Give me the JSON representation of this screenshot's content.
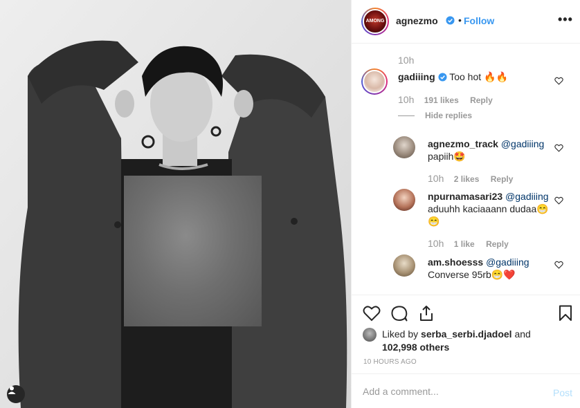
{
  "header": {
    "username": "agnezmo",
    "avatar_text": "AMONG",
    "separator": "•",
    "follow_label": "Follow",
    "more_label": "•••",
    "verified_icon": "verified-badge-icon",
    "accent_color": "#3897f0"
  },
  "comments": {
    "top_timestamp": "10h",
    "main": {
      "username": "gadiiing",
      "text": "Too hot 🔥🔥",
      "timestamp": "10h",
      "likes": "191 likes",
      "reply_label": "Reply",
      "hide_replies_label": "Hide replies"
    },
    "replies": [
      {
        "username": "agnezmo_track",
        "mention": "@gadiiing",
        "text": "papiih🤩",
        "timestamp": "10h",
        "likes": "2 likes",
        "reply_label": "Reply"
      },
      {
        "username": "npurnamasari23",
        "mention": "@gadiiing",
        "text": "aduuhh kaciaaann dudaa😁 😁",
        "timestamp": "10h",
        "likes": "1 like",
        "reply_label": "Reply"
      },
      {
        "username": "am.shoesss",
        "mention": "@gadiiing",
        "text": "Converse 95rb😁❤️"
      }
    ]
  },
  "actions": {
    "liked_by_prefix": "Liked by",
    "liked_by_user": "serba_serbi.djadoel",
    "liked_by_and": "and",
    "others": "102,998 others",
    "post_timestamp": "10 HOURS AGO",
    "icons": [
      "heart-icon",
      "comment-icon",
      "share-icon",
      "bookmark-icon"
    ]
  },
  "add_comment": {
    "placeholder": "Add a comment...",
    "post_label": "Post"
  },
  "photo": {
    "user_tag_icon": "user-tag-icon"
  }
}
